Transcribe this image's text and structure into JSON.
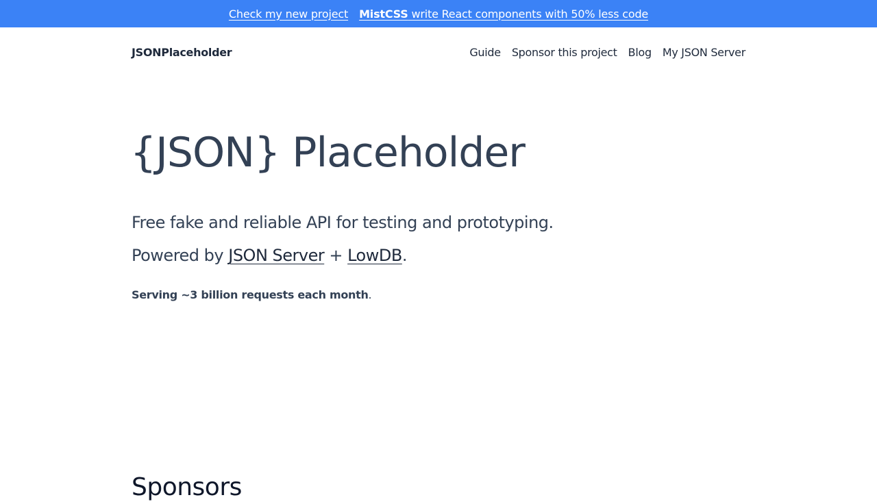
{
  "banner": {
    "prefix": "Check my new project",
    "project_name": "MistCSS",
    "description": " write React components with 50% less code",
    "background_color": "#3b82f6"
  },
  "header": {
    "brand": "JSONPlaceholder",
    "nav": [
      {
        "label": "Guide"
      },
      {
        "label": "Sponsor this project"
      },
      {
        "label": "Blog"
      },
      {
        "label": "My JSON Server"
      }
    ]
  },
  "hero": {
    "title": "{JSON} Placeholder",
    "tagline": "Free fake and reliable API for testing and prototyping.",
    "powered_prefix": "Powered by ",
    "powered_link_1": "JSON Server",
    "powered_join": " + ",
    "powered_link_2": "LowDB",
    "powered_suffix": ".",
    "stats_bold": "Serving ~3 billion requests each month",
    "stats_suffix": "."
  },
  "sponsors": {
    "heading": "Sponsors"
  }
}
